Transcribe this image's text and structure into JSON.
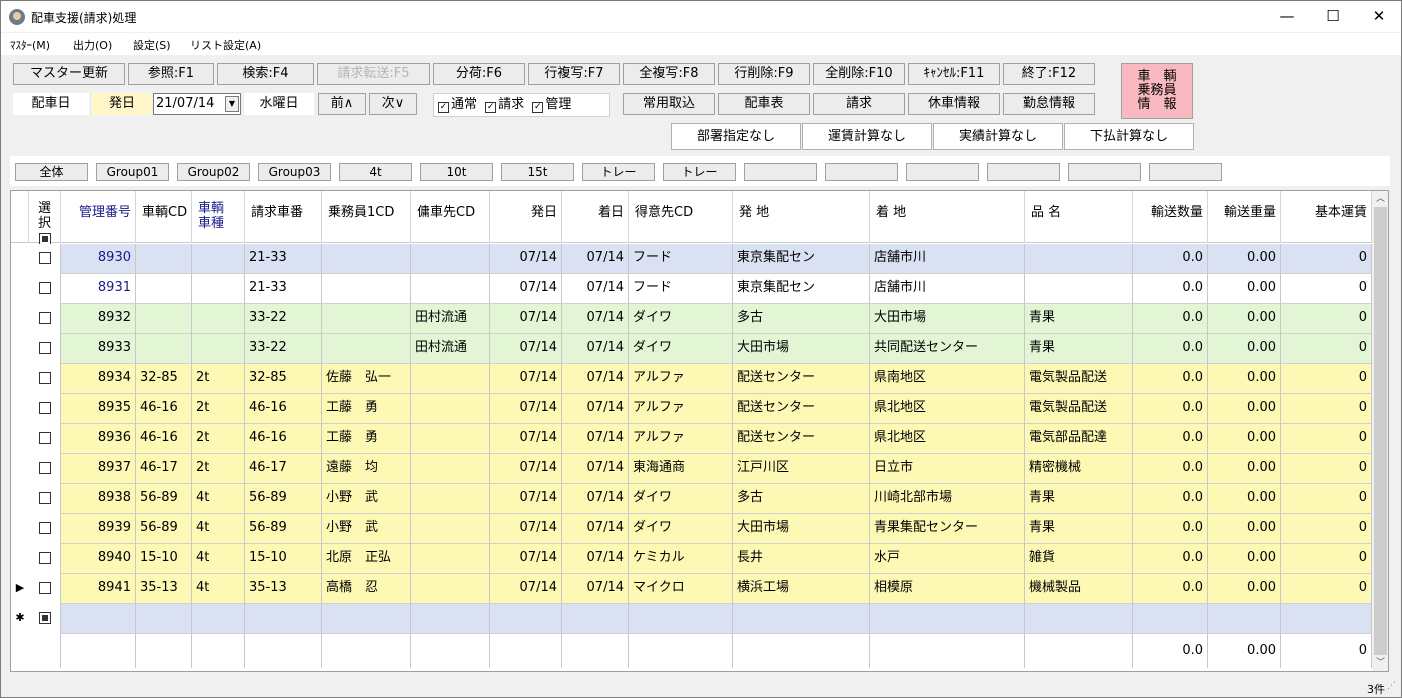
{
  "window": {
    "title": "配車支援(請求)処理",
    "minimize": "—",
    "maximize": "☐",
    "close": "✕"
  },
  "menu": [
    "ﾏｽﾀｰ(M)",
    "出力(O)",
    "設定(S)",
    "リスト設定(A)"
  ],
  "toolbar": [
    "マスター更新",
    "参照:F1",
    "検索:F4",
    "請求転送:F5",
    "分荷:F6",
    "行複写:F7",
    "全複写:F8",
    "行削除:F9",
    "全削除:F10",
    "ｷｬﾝｾﾙ:F11",
    "終了:F12"
  ],
  "info_button": [
    "車　輌",
    "乗務員",
    "情　報"
  ],
  "date_row": {
    "label1": "配車日",
    "label2": "発日",
    "date": "21/07/14",
    "weekday": "水曜日",
    "prev": "前∧",
    "next": "次∨"
  },
  "checks": [
    {
      "label": "通常",
      "checked": true
    },
    {
      "label": "請求",
      "checked": true
    },
    {
      "label": "管理",
      "checked": true
    }
  ],
  "func_buttons": [
    "常用取込",
    "配車表",
    "請求",
    "休車情報",
    "勤怠情報"
  ],
  "tabs": [
    "部署指定なし",
    "運賃計算なし",
    "実績計算なし",
    "下払計算なし"
  ],
  "groups": [
    "全体",
    "Group01",
    "Group02",
    "Group03",
    "4t",
    "10t",
    "15t",
    "トレー",
    "トレー",
    "",
    "",
    "",
    "",
    "",
    ""
  ],
  "columns": [
    "選択",
    "管理番号",
    "車輌CD",
    "車輌車種",
    "請求車番",
    "乗務員1CD",
    "傭車先CD",
    "発日",
    "着日",
    "得意先CD",
    "発 地",
    "着 地",
    "品 名",
    "輸送数量",
    "輸送重量",
    "基本運賃"
  ],
  "rows": [
    {
      "id": "8930",
      "car": "",
      "type": "",
      "no": "21-33",
      "crew": "",
      "sub": "",
      "dep": "07/14",
      "arr": "07/14",
      "cust": "フード",
      "from": "東京集配セン",
      "to": "店舗市川",
      "item": "",
      "qty": "0.0",
      "wt": "0.00",
      "fare": "0",
      "bg": "#d9e1f2",
      "blue": true
    },
    {
      "id": "8931",
      "car": "",
      "type": "",
      "no": "21-33",
      "crew": "",
      "sub": "",
      "dep": "07/14",
      "arr": "07/14",
      "cust": "フード",
      "from": "東京集配セン",
      "to": "店舗市川",
      "item": "",
      "qty": "0.0",
      "wt": "0.00",
      "fare": "0",
      "bg": "#ffffff",
      "blue": true
    },
    {
      "id": "8932",
      "car": "",
      "type": "",
      "no": "33-22",
      "crew": "",
      "sub": "田村流通",
      "dep": "07/14",
      "arr": "07/14",
      "cust": "ダイワ",
      "from": "多古",
      "to": "大田市場",
      "item": "青果",
      "qty": "0.0",
      "wt": "0.00",
      "fare": "0",
      "bg": "#e2f6d6",
      "blue": false
    },
    {
      "id": "8933",
      "car": "",
      "type": "",
      "no": "33-22",
      "crew": "",
      "sub": "田村流通",
      "dep": "07/14",
      "arr": "07/14",
      "cust": "ダイワ",
      "from": "大田市場",
      "to": "共同配送センター",
      "item": "青果",
      "qty": "0.0",
      "wt": "0.00",
      "fare": "0",
      "bg": "#e2f6d6",
      "blue": false
    },
    {
      "id": "8934",
      "car": "32-85",
      "type": "2t",
      "no": "32-85",
      "crew": "佐藤　弘一",
      "sub": "",
      "dep": "07/14",
      "arr": "07/14",
      "cust": "アルファ",
      "from": "配送センター",
      "to": "県南地区",
      "item": "電気製品配送",
      "qty": "0.0",
      "wt": "0.00",
      "fare": "0",
      "bg": "#fdf8b4",
      "blue": false
    },
    {
      "id": "8935",
      "car": "46-16",
      "type": "2t",
      "no": "46-16",
      "crew": "工藤　勇",
      "sub": "",
      "dep": "07/14",
      "arr": "07/14",
      "cust": "アルファ",
      "from": "配送センター",
      "to": "県北地区",
      "item": "電気製品配送",
      "qty": "0.0",
      "wt": "0.00",
      "fare": "0",
      "bg": "#fdf8b4",
      "blue": false
    },
    {
      "id": "8936",
      "car": "46-16",
      "type": "2t",
      "no": "46-16",
      "crew": "工藤　勇",
      "sub": "",
      "dep": "07/14",
      "arr": "07/14",
      "cust": "アルファ",
      "from": "配送センター",
      "to": "県北地区",
      "item": "電気部品配達",
      "qty": "0.0",
      "wt": "0.00",
      "fare": "0",
      "bg": "#fdf8b4",
      "blue": false
    },
    {
      "id": "8937",
      "car": "46-17",
      "type": "2t",
      "no": "46-17",
      "crew": "遠藤　均",
      "sub": "",
      "dep": "07/14",
      "arr": "07/14",
      "cust": "東海通商",
      "from": "江戸川区",
      "to": "日立市",
      "item": "精密機械",
      "qty": "0.0",
      "wt": "0.00",
      "fare": "0",
      "bg": "#fdf8b4",
      "blue": false
    },
    {
      "id": "8938",
      "car": "56-89",
      "type": "4t",
      "no": "56-89",
      "crew": "小野　武",
      "sub": "",
      "dep": "07/14",
      "arr": "07/14",
      "cust": "ダイワ",
      "from": "多古",
      "to": "川崎北部市場",
      "item": "青果",
      "qty": "0.0",
      "wt": "0.00",
      "fare": "0",
      "bg": "#fdf8b4",
      "blue": false
    },
    {
      "id": "8939",
      "car": "56-89",
      "type": "4t",
      "no": "56-89",
      "crew": "小野　武",
      "sub": "",
      "dep": "07/14",
      "arr": "07/14",
      "cust": "ダイワ",
      "from": "大田市場",
      "to": "青果集配センター",
      "item": "青果",
      "qty": "0.0",
      "wt": "0.00",
      "fare": "0",
      "bg": "#fdf8b4",
      "blue": false
    },
    {
      "id": "8940",
      "car": "15-10",
      "type": "4t",
      "no": "15-10",
      "crew": "北原　正弘",
      "sub": "",
      "dep": "07/14",
      "arr": "07/14",
      "cust": "ケミカル",
      "from": "長井",
      "to": "水戸",
      "item": "雑貨",
      "qty": "0.0",
      "wt": "0.00",
      "fare": "0",
      "bg": "#fdf8b4",
      "blue": false
    },
    {
      "id": "8941",
      "car": "35-13",
      "type": "4t",
      "no": "35-13",
      "crew": "高橋　忍",
      "sub": "",
      "dep": "07/14",
      "arr": "07/14",
      "cust": "マイクロ",
      "from": "横浜工場",
      "to": "相模原",
      "item": "機械製品",
      "qty": "0.0",
      "wt": "0.00",
      "fare": "0",
      "bg": "#fdf8b4",
      "blue": false
    }
  ],
  "totals": {
    "qty": "0.0",
    "wt": "0.00",
    "fare": "0"
  },
  "status": "3件",
  "colors": {
    "pink": "#f8b9c0",
    "yellow": "#fdf8b4",
    "green": "#e2f6d6",
    "blue": "#d9e1f2"
  }
}
